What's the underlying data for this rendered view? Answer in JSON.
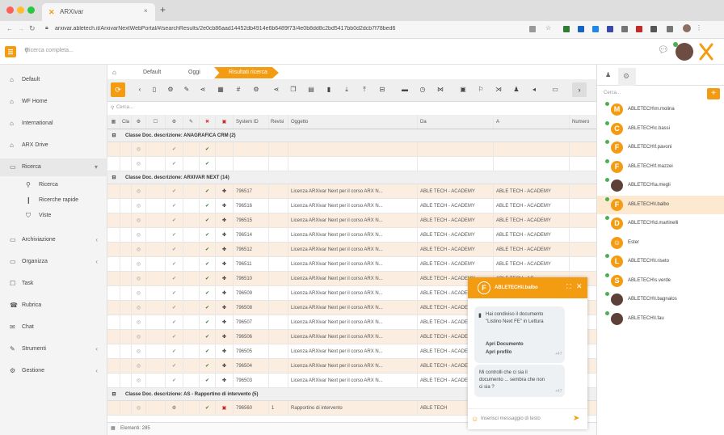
{
  "browser": {
    "tab_title": "ARXivar",
    "url": "arxivar.abletech.it/ArxivarNextWebPortal/#/searchResults/2e0cb86aad14452db4914e6b6489f73/4e0b8dd8c2bd5417bb0d2dcb7f78bed6",
    "colors": {
      "close": "#fe5f57",
      "minimize": "#febc2e",
      "maximize": "#28c840"
    }
  },
  "app": {
    "search_placeholder": "Ricerca completa...",
    "accent": "#f39c12"
  },
  "sidebar": {
    "items": [
      {
        "icon": "home-icon",
        "label": "Default"
      },
      {
        "icon": "home-icon",
        "label": "WF Home"
      },
      {
        "icon": "home-icon",
        "label": "International"
      },
      {
        "icon": "home-icon",
        "label": "ARX Drive"
      },
      {
        "icon": "folder-icon",
        "label": "Ricerca"
      },
      {
        "icon": "search-icon",
        "label": "Ricerca"
      },
      {
        "icon": "bookmark-icon",
        "label": "Ricerche rapide"
      },
      {
        "icon": "filter-icon",
        "label": "Viste"
      },
      {
        "icon": "archive-icon",
        "label": "Archiviazione"
      },
      {
        "icon": "folder-icon",
        "label": "Organizza"
      },
      {
        "icon": "task-icon",
        "label": "Task"
      },
      {
        "icon": "contacts-icon",
        "label": "Rubrica"
      },
      {
        "icon": "chat-icon",
        "label": "Chat"
      },
      {
        "icon": "tools-icon",
        "label": "Strumenti"
      },
      {
        "icon": "gear-icon",
        "label": "Gestione"
      }
    ]
  },
  "breadcrumb": {
    "home_icon": "home-icon",
    "items": [
      "Default",
      "Oggi",
      "Risultati ricerca"
    ]
  },
  "grid": {
    "filter_placeholder": "Cerca...",
    "columns": [
      "Cla",
      "System ID",
      "Revisi",
      "Oggetto",
      "Da",
      "A",
      "Numero"
    ],
    "groups": [
      {
        "label": "Classe Doc. descrizione: ANAGRAFICA CRM (2)",
        "rows": [
          {},
          {}
        ]
      },
      {
        "label": "Classe Doc. descrizione: ARXIVAR NEXT (14)",
        "rows": [
          {
            "id": "796517",
            "oggetto": "Licenza ARXivar Next per il corso ARX N...",
            "da": "ABLE TECH - ACADEMY",
            "a": "ABLE TECH - ACADEMY"
          },
          {
            "id": "796516",
            "oggetto": "Licenza ARXivar Next per il corso ARX N...",
            "da": "ABLE TECH - ACADEMY",
            "a": "ABLE TECH - ACADEMY"
          },
          {
            "id": "796515",
            "oggetto": "Licenza ARXivar Next per il corso ARX N...",
            "da": "ABLE TECH - ACADEMY",
            "a": "ABLE TECH - ACADEMY"
          },
          {
            "id": "796514",
            "oggetto": "Licenza ARXivar Next per il corso ARX N...",
            "da": "ABLE TECH - ACADEMY",
            "a": "ABLE TECH - ACADEMY"
          },
          {
            "id": "796512",
            "oggetto": "Licenza ARXivar Next per il corso ARX N...",
            "da": "ABLE TECH - ACADEMY",
            "a": "ABLE TECH - ACADEMY"
          },
          {
            "id": "796511",
            "oggetto": "Licenza ARXivar Next per il corso ARX N...",
            "da": "ABLE TECH - ACADEMY",
            "a": "ABLE TECH - ACADEMY"
          },
          {
            "id": "796510",
            "oggetto": "Licenza ARXivar Next per il corso ARX N...",
            "da": "ABLE TECH - ACADEMY",
            "a": "ABLE TECH - AC"
          },
          {
            "id": "796509",
            "oggetto": "Licenza ARXivar Next per il corso ARX N...",
            "da": "ABLE TECH - ACADEMY",
            "a": "ABLE TECH - AC"
          },
          {
            "id": "796508",
            "oggetto": "Licenza ARXivar Next per il corso ARX N...",
            "da": "ABLE TECH - ACADEMY",
            "a": "ABLE TECH - AC"
          },
          {
            "id": "796507",
            "oggetto": "Licenza ARXivar Next per il corso ARX N...",
            "da": "ABLE TECH - ACADEMY",
            "a": "ABLE TECH - AC"
          },
          {
            "id": "796506",
            "oggetto": "Licenza ARXivar Next per il corso ARX N...",
            "da": "ABLE TECH - ACADEMY",
            "a": "ABLE TECH - AC"
          },
          {
            "id": "796505",
            "oggetto": "Licenza ARXivar Next per il corso ARX N...",
            "da": "ABLE TECH - ACADEMY",
            "a": "ABLE TECH - AC"
          },
          {
            "id": "796504",
            "oggetto": "Licenza ARXivar Next per il corso ARX N...",
            "da": "ABLE TECH - ACADEMY",
            "a": "ABLE TECH - AC"
          },
          {
            "id": "796503",
            "oggetto": "Licenza ARXivar Next per il corso ARX N...",
            "da": "ABLE TECH - ACADEMY",
            "a": "ABLE TECH - AC"
          }
        ]
      },
      {
        "label": "Classe Doc. descrizione: AS - Rapportino di intervento (5)",
        "rows": [
          {
            "id": "796560",
            "rev": "1",
            "oggetto": "Rapportino di intervento",
            "da": "ABLE TECH",
            "a": ""
          }
        ]
      }
    ],
    "footer": "Elementi: 285"
  },
  "chat": {
    "contact": "ABLETECH\\l.balbo",
    "messages": [
      {
        "text": "Hai condiviso il documento \"Listino Next FE\" in Lettura",
        "links": [
          "Apri Documento",
          "Apri profilo"
        ],
        "time": "+47"
      },
      {
        "text": "Mi controlli che ci sia il documento ... sembra che non ci sia ?",
        "time": "+47"
      }
    ],
    "input_placeholder": "Inserisci messaggio di testo"
  },
  "contacts": {
    "search_placeholder": "Cerca...",
    "items": [
      {
        "initial": "M",
        "name": "ABLETECH\\m.molina",
        "online": true
      },
      {
        "initial": "C",
        "name": "ABLETECH\\c.bassi",
        "online": true
      },
      {
        "initial": "F",
        "name": "ABLETECH\\f.pavoni",
        "online": true
      },
      {
        "initial": "F",
        "name": "ABLETECH\\f.mazzei",
        "online": true
      },
      {
        "initial": "",
        "name": "ABLETECH\\a.megli",
        "online": true,
        "photo": true
      },
      {
        "initial": "F",
        "name": "ABLETECH\\l.balbo",
        "online": true,
        "selected": true
      },
      {
        "initial": "D",
        "name": "ABLETECH\\d.martinelli",
        "online": true
      },
      {
        "initial": "",
        "name": "Ester",
        "online": false
      },
      {
        "initial": "L",
        "name": "ABLETECH\\l.riseto",
        "online": true
      },
      {
        "initial": "S",
        "name": "ABLETECH\\s.verde",
        "online": true
      },
      {
        "initial": "",
        "name": "ABLETECH\\l.bagnalos",
        "online": true,
        "photo": true
      },
      {
        "initial": "",
        "name": "ABLETECH\\l.fau",
        "online": true,
        "photo": true
      }
    ]
  }
}
